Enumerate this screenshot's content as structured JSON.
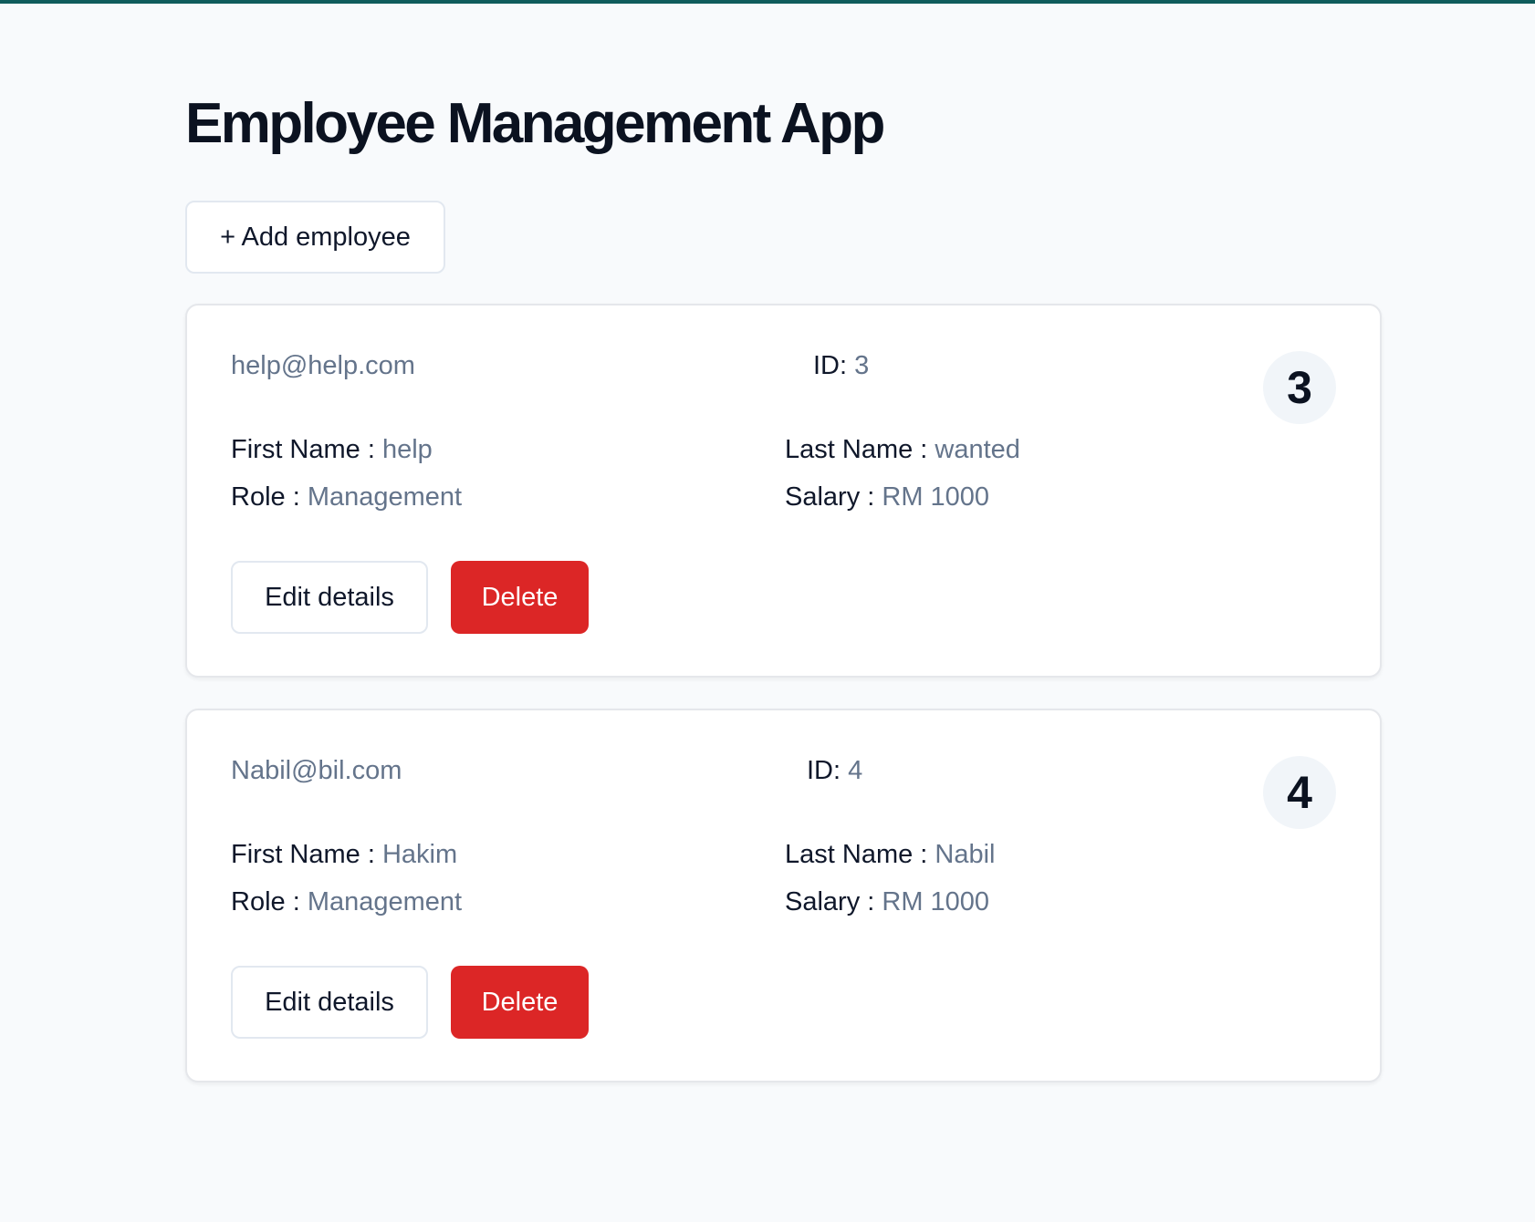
{
  "header": {
    "title": "Employee Management App",
    "add_button_label": "+ Add employee"
  },
  "labels": {
    "id": "ID:",
    "first_name": "First Name :",
    "last_name": "Last Name :",
    "role": "Role :",
    "salary": "Salary :",
    "edit": "Edit details",
    "delete": "Delete"
  },
  "employees": [
    {
      "email": "help@help.com",
      "id": "3",
      "badge": "3",
      "first_name": "help",
      "last_name": "wanted",
      "role": "Management",
      "salary": "RM 1000"
    },
    {
      "email": "Nabil@bil.com",
      "id": "4",
      "badge": "4",
      "first_name": "Hakim",
      "last_name": "Nabil",
      "role": "Management",
      "salary": "RM 1000"
    }
  ],
  "colors": {
    "accent_bar": "#0f5c5c",
    "delete": "#dc2626",
    "muted_text": "#64748b"
  }
}
